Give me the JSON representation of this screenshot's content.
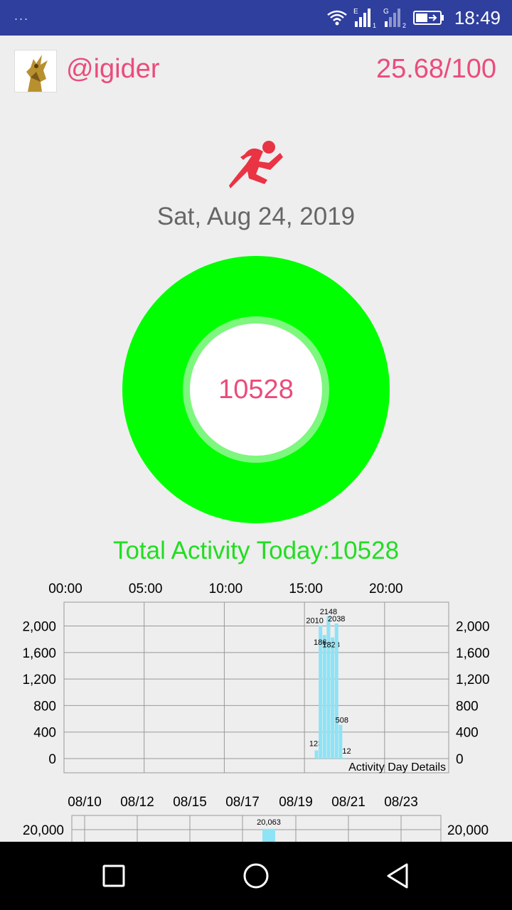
{
  "status_bar": {
    "dots": "...",
    "signal_labels": [
      "E",
      "1",
      "G",
      "2"
    ],
    "time": "18:49",
    "icons": [
      "wifi-icon",
      "signal-sim1-icon",
      "signal-sim2-icon",
      "battery-icon"
    ]
  },
  "header": {
    "username": "@igider",
    "score": "25.68/100"
  },
  "activity_icon": "running-person-icon",
  "date": "Sat, Aug 24, 2019",
  "ring": {
    "value": "10528",
    "color": "#00ff00"
  },
  "total_label": "Total Activity Today:10528",
  "colors": {
    "accent": "#ea4c7c",
    "green": "#00ff00",
    "bar": "#8ee3f5"
  },
  "chart_data": [
    {
      "type": "bar",
      "x_tick_labels": [
        "00:00",
        "05:00",
        "10:00",
        "15:00",
        "20:00"
      ],
      "y_tick_labels": [
        "2,000",
        "1,600",
        "1,200",
        "800",
        "400",
        "0"
      ],
      "ylim": [
        0,
        2360
      ],
      "xlim_hours": [
        0,
        24
      ],
      "description": "Activity Day Details",
      "bars": [
        {
          "hour": 15.75,
          "value": 123,
          "label": "123"
        },
        {
          "hour": 16.0,
          "value": 2010,
          "label": "2010"
        },
        {
          "hour": 16.25,
          "value": 1864,
          "label": "1864"
        },
        {
          "hour": 16.5,
          "value": 2148,
          "label": "2148"
        },
        {
          "hour": 16.75,
          "value": 1828,
          "label": "1828"
        },
        {
          "hour": 17.0,
          "value": 2038,
          "label": "2038"
        },
        {
          "hour": 17.25,
          "value": 508,
          "label": "508"
        },
        {
          "hour": 17.5,
          "value": 12,
          "label": "12"
        }
      ]
    },
    {
      "type": "bar",
      "x_tick_labels": [
        "08/10",
        "08/12",
        "08/15",
        "08/17",
        "08/19",
        "08/21",
        "08/23"
      ],
      "y_tick_labels": [
        "20,000"
      ],
      "bars": [
        {
          "date": "08/18",
          "value": 20063,
          "label": "20,063"
        }
      ]
    }
  ],
  "nav": {
    "icons": [
      "recents-square-icon",
      "home-circle-icon",
      "back-triangle-icon"
    ]
  }
}
